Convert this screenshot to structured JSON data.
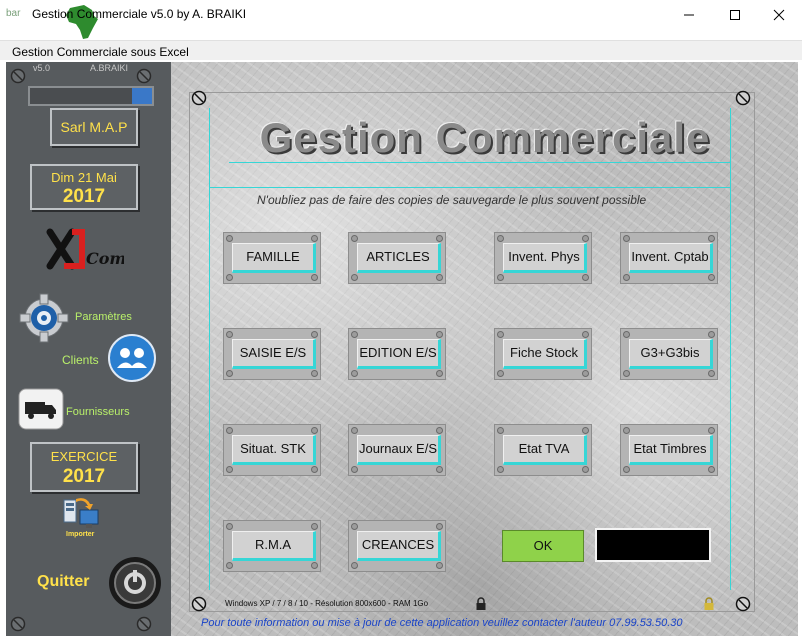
{
  "window": {
    "title": "Gestion Commerciale v5.0  by A.  BRAIKI",
    "subtitle": "Gestion Commerciale sous Excel"
  },
  "sidebar": {
    "version": "v5.0",
    "author": "A.BRAIKI",
    "company": "Sarl M.A.P",
    "date_line": "Dim 21 Mai",
    "date_year": "2017",
    "params_label": "Paramètres",
    "clients_label": "Clients",
    "suppliers_label": "Fournisseurs",
    "exercice_label": "EXERCICE",
    "exercice_year": "2017",
    "import_label": "Importer",
    "quit_label": "Quitter"
  },
  "main": {
    "title": "Gestion Commerciale",
    "notice": "N'oubliez pas de faire des copies de sauvegarde le plus souvent possible",
    "buttons": [
      [
        "FAMILLE",
        "ARTICLES",
        "Invent. Phys",
        "Invent. Cptab"
      ],
      [
        "SAISIE E/S",
        "EDITION E/S",
        "Fiche Stock",
        "G3+G3bis"
      ],
      [
        "Situat. STK",
        "Journaux E/S",
        "Etat TVA",
        "Etat Timbres"
      ],
      [
        "R.M.A",
        "CREANCES"
      ]
    ],
    "ok_label": "OK",
    "footer_info": "Windows XP / 7 / 8 / 10 - Résolution 800x600 - RAM 1Go",
    "footer_contact": "Pour toute information ou mise à jour de cette application veuillez contacter l'auteur 07.99.53.50.30"
  },
  "colors": {
    "sidebar_bg": "#575b5e",
    "yellow_text": "#ffe14a",
    "green_text": "#b9f06a",
    "accent_cyan": "#36d6d6",
    "ok_green": "#8fd24a",
    "contact_blue": "#1a44c8"
  },
  "icons": [
    "minimize-icon",
    "maximize-icon",
    "close-icon",
    "gear-icon",
    "clients-icon",
    "truck-icon",
    "import-icon",
    "power-icon",
    "lock-icon"
  ]
}
